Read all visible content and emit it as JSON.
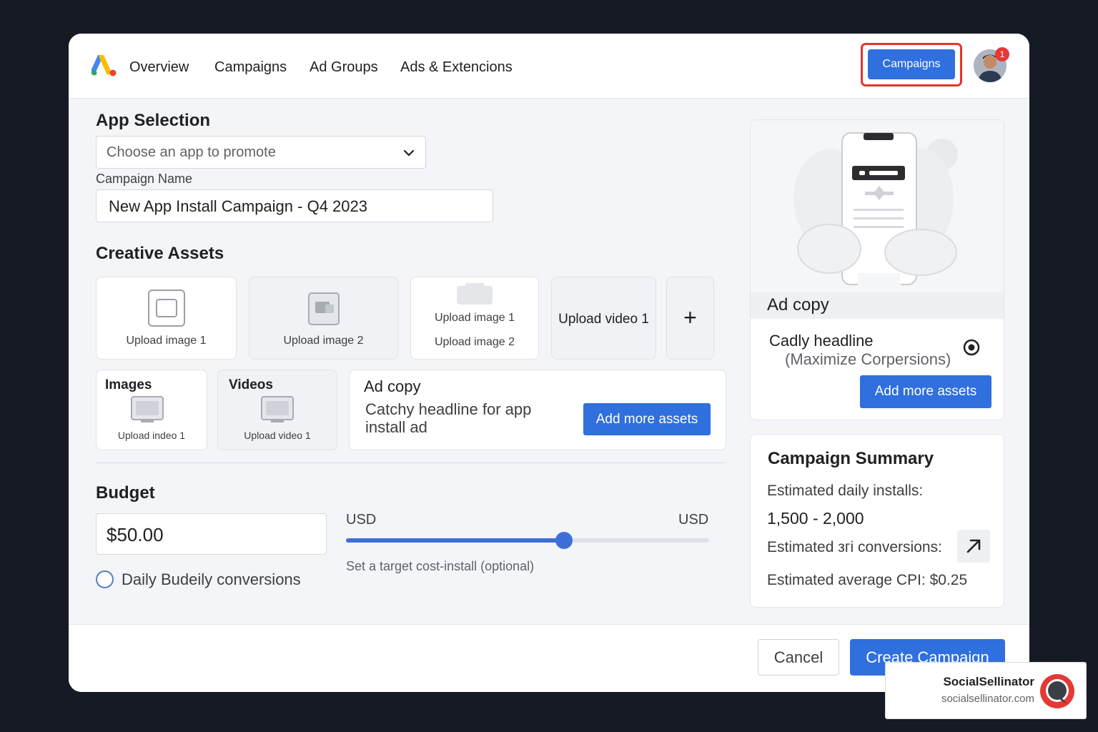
{
  "nav": {
    "items": [
      "Overview",
      "Campaigns",
      "Ad Groups",
      "Ads & Extencions"
    ],
    "cta_label": "Campaigns",
    "notification_count": "1"
  },
  "app_selection": {
    "heading": "App Selection",
    "placeholder": "Choose an app to promote"
  },
  "campaign_name": {
    "label": "Campaign Name",
    "value": "New App Install Campaign - Q4 2023"
  },
  "creative_assets": {
    "heading": "Creative Assets",
    "tiles": {
      "upload_image_1": "Upload image 1",
      "upload_image_2": "Upload image 2",
      "stacked_line_1": "Upload image 1",
      "stacked_line_2": "Upload image 2",
      "upload_video_1": "Upload video 1",
      "add_symbol": "+"
    },
    "images_card": {
      "title": "Images",
      "caption": "Upload indeo 1"
    },
    "videos_card": {
      "title": "Videos",
      "caption": "Upload video 1"
    },
    "ad_copy": {
      "title": "Ad copy",
      "body": "Catchy headline for app install ad",
      "button": "Add more assets"
    }
  },
  "budget": {
    "heading": "Budget",
    "value": "$50.00",
    "radio_label": "Daily Budeily conversions",
    "currency_left": "USD",
    "currency_right": "USD",
    "slider_level": 0.6,
    "slider_note": "Set a target cost-install (optional)"
  },
  "preview": {
    "ad_copy_label": "Ad copy",
    "headline": "Cadly headline",
    "subline": "(Maximize Corpersions)",
    "button": "Add more assets"
  },
  "summary": {
    "title": "Campaign Summary",
    "installs_label": "Estimated daily installs:",
    "installs_value": "1,500 - 2,000",
    "conversions_label": "Estimated згi conversions:",
    "cpi_label": "Estimated average CPI: $0.25"
  },
  "footer": {
    "cancel": "Cancel",
    "create": "Create Campaign"
  },
  "watermark": {
    "name": "SocialSellinator",
    "url": "socialsellinator.com"
  },
  "colors": {
    "primary_blue": "#2f6fde",
    "highlight_red": "#e3342f",
    "background": "#161a24"
  }
}
